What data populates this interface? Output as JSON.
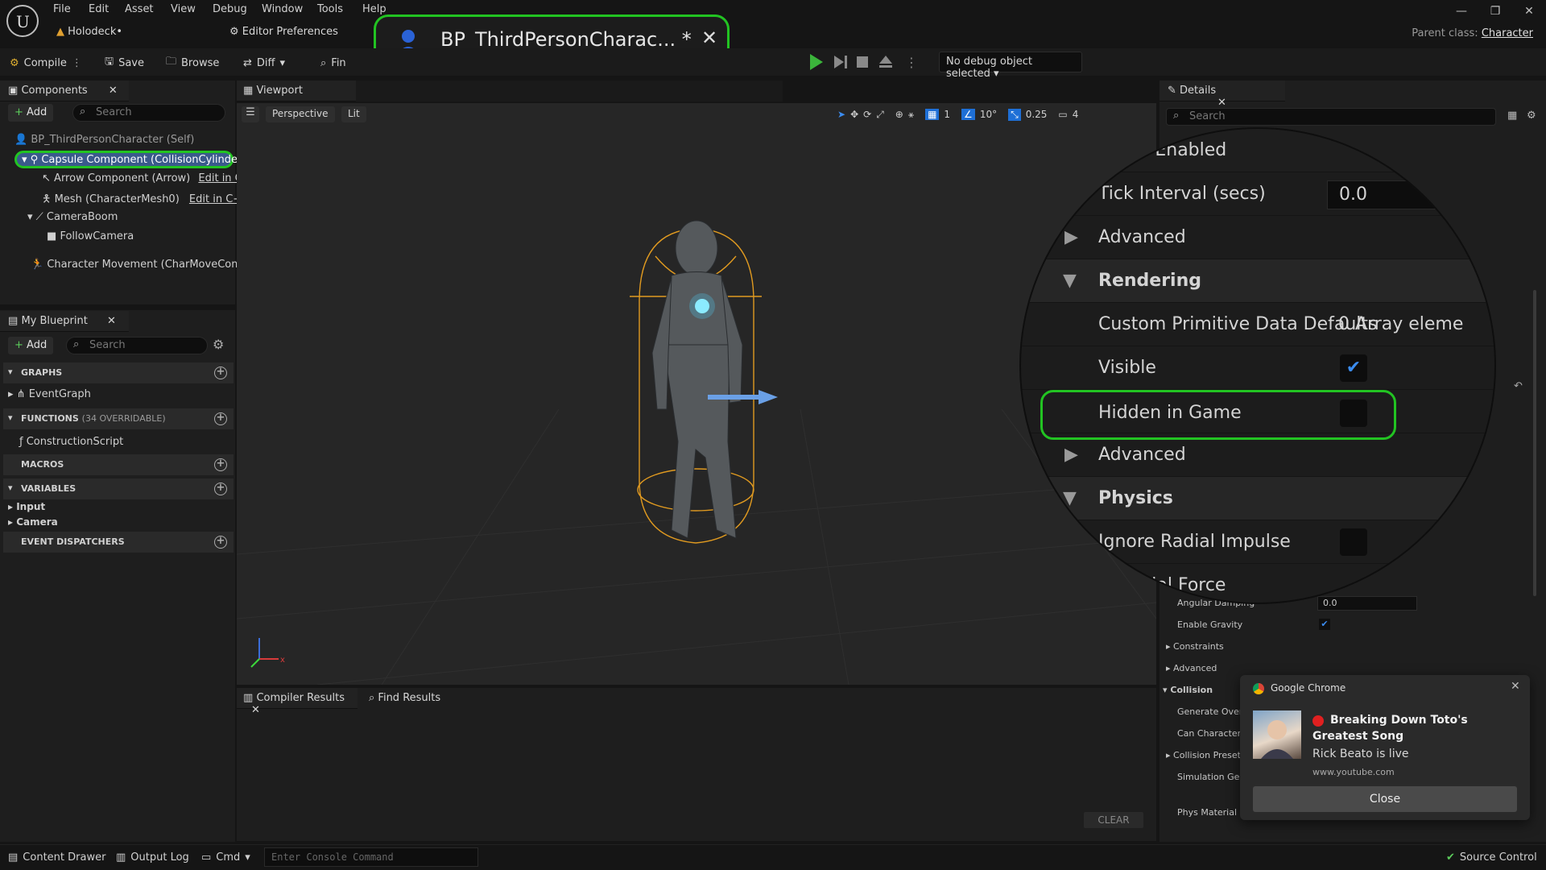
{
  "menu": [
    "File",
    "Edit",
    "Asset",
    "View",
    "Debug",
    "Window",
    "Tools",
    "Help"
  ],
  "project_tab": "Holodeck•",
  "editor_prefs_tab": "Editor Preferences",
  "blueprint_tab": {
    "label": "BP_ThirdPersonCharac...",
    "modified": "*"
  },
  "parent_class": {
    "label": "Parent class:",
    "value": "Character"
  },
  "toolbar": {
    "compile": "Compile",
    "save": "Save",
    "browse": "Browse",
    "diff": "Diff",
    "find": "Fin",
    "debug_object": "No debug object selected"
  },
  "components_panel": {
    "title": "Components",
    "add": "Add",
    "search_placeholder": "Search",
    "items": [
      "BP_ThirdPersonCharacter (Self)",
      "Capsule Component (CollisionCylinder)",
      "Arrow Component (Arrow)",
      "Mesh (CharacterMesh0)",
      "CameraBoom",
      "FollowCamera",
      "Character Movement (CharMoveComp)"
    ],
    "edit_cpp": "Edit in C++"
  },
  "my_blueprint": {
    "title": "My Blueprint",
    "add": "Add",
    "search_placeholder": "Search",
    "graphs": "GRAPHS",
    "event_graph": "EventGraph",
    "functions": "FUNCTIONS",
    "functions_count": "(34 OVERRIDABLE)",
    "construction_script": "ConstructionScript",
    "macros": "MACROS",
    "variables": "VARIABLES",
    "var_input": "Input",
    "var_camera": "Camera",
    "event_dispatchers": "EVENT DISPATCHERS"
  },
  "viewport": {
    "tab": "Viewport",
    "perspective": "Perspective",
    "lit": "Lit",
    "grid_num": "1",
    "angle": "10°",
    "scale": "0.25",
    "camera_speed": "4"
  },
  "details": {
    "title": "Details",
    "search_placeholder": "Search",
    "rows": [
      {
        "label": "Angular Damping",
        "value": "0.0"
      },
      {
        "label": "Enable Gravity",
        "checked": true
      },
      {
        "label": "Constraints"
      },
      {
        "label": "Advanced"
      },
      {
        "label": "Collision"
      },
      {
        "label": "Generate Overla"
      },
      {
        "label": "Can Character S"
      },
      {
        "label": "Collision Preset"
      },
      {
        "label": "Simulation Gene"
      },
      {
        "label": "Phys Material C"
      }
    ]
  },
  "magnifier": {
    "start_tick": "...rt Tick Enabled",
    "tick_interval": "Tick Interval (secs)",
    "tick_value": "0.0",
    "advanced1": "Advanced",
    "rendering": "Rendering",
    "custom_prim": "Custom Primitive Data Defaults",
    "custom_prim_value": "0 Array eleme",
    "visible": "Visible",
    "hidden_in_game": "Hidden in Game",
    "advanced2": "Advanced",
    "physics": "Physics",
    "ignore_radial_impulse": "Ignore Radial Impulse",
    "radial_force": "Radial Force"
  },
  "bottom": {
    "compiler_results": "Compiler Results",
    "find_results": "Find Results",
    "clear": "CLEAR"
  },
  "status": {
    "content_drawer": "Content Drawer",
    "output_log": "Output Log",
    "cmd": "Cmd",
    "console_placeholder": "Enter Console Command",
    "source_control": "Source Control"
  },
  "notification": {
    "app": "Google Chrome",
    "title": "Breaking Down Toto's Greatest Song",
    "subtitle": "Rick Beato is live",
    "url": "www.youtube.com",
    "close": "Close"
  },
  "colors": {
    "highlight": "#22c322",
    "accent": "#1e6fd6",
    "selection": "#3a5a8c"
  }
}
